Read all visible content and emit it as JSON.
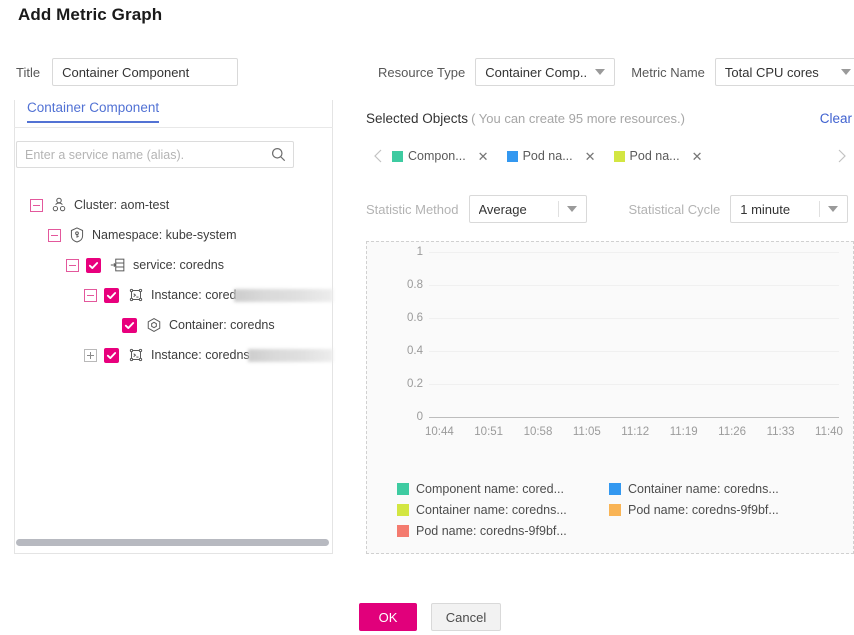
{
  "dialog": {
    "title": "Add Metric Graph"
  },
  "title_field": {
    "label": "Title",
    "value": "Container Component",
    "placeholder": ""
  },
  "resource_type": {
    "label": "Resource Type",
    "value": "Container Comp...",
    "caret_icon": "chevron-down-icon"
  },
  "metric_name": {
    "label": "Metric Name",
    "value": "Total CPU cores",
    "caret_icon": "chevron-down-icon"
  },
  "left_panel": {
    "tab": "Container Component",
    "search_placeholder": "Enter a service name (alias).",
    "search_value": "",
    "search_icon": "search-icon",
    "tree": [
      {
        "label": "Cluster: aom-test",
        "indent": 0,
        "expander": "minus",
        "expander_color": "pink",
        "checkbox": false,
        "icon": "cluster-icon",
        "redacted": false
      },
      {
        "label": "Namespace: kube-system",
        "indent": 1,
        "expander": "minus",
        "expander_color": "pink",
        "checkbox": false,
        "icon": "namespace-icon",
        "redacted": false
      },
      {
        "label": "service: coredns",
        "indent": 2,
        "expander": "minus",
        "expander_color": "pink",
        "checkbox": true,
        "icon": "service-icon",
        "redacted": false
      },
      {
        "label": "Instance: cored",
        "indent": 3,
        "expander": "minus",
        "expander_color": "pink",
        "checkbox": true,
        "icon": "instance-icon",
        "redacted": true,
        "redact_width": 118
      },
      {
        "label": "Container: coredns",
        "indent": 4,
        "expander": "none",
        "expander_color": "pink",
        "checkbox": true,
        "icon": "container-icon",
        "redacted": false
      },
      {
        "label": "Instance: coredns",
        "indent": 3,
        "expander": "plus",
        "expander_color": "gray",
        "checkbox": true,
        "icon": "instance-icon",
        "redacted": true,
        "redact_width": 96
      }
    ]
  },
  "selected_objects": {
    "title": "Selected Objects",
    "hint": "( You can create 95 more resources.)",
    "clear_label": "Clear",
    "prev_icon": "chevron-left-icon",
    "next_icon": "chevron-right-icon",
    "tags": [
      {
        "label": "Compon...",
        "color": "#3ecba1",
        "close_icon": "close-icon"
      },
      {
        "label": "Pod na...",
        "color": "#3398f0",
        "close_icon": "close-icon"
      },
      {
        "label": "Pod na...",
        "color": "#d3e642",
        "close_icon": "close-icon"
      }
    ]
  },
  "statistic_method": {
    "label": "Statistic Method",
    "value": "Average",
    "caret_icon": "chevron-down-icon"
  },
  "statistical_cycle": {
    "label": "Statistical Cycle",
    "value": "1 minute",
    "caret_icon": "chevron-down-icon"
  },
  "chart_data": {
    "type": "line",
    "title": "",
    "xlabel": "",
    "ylabel": "",
    "x": [
      "10:44",
      "10:51",
      "10:58",
      "11:05",
      "11:12",
      "11:19",
      "11:26",
      "11:33",
      "11:40"
    ],
    "y_ticks": [
      "1",
      "0.8",
      "0.6",
      "0.4",
      "0.2",
      "0"
    ],
    "ylim": [
      0,
      1
    ],
    "grid": true,
    "legend_position": "bottom",
    "series": [
      {
        "name": "Component name: cored...",
        "color": "#3ecba1",
        "values": []
      },
      {
        "name": "Container name: coredns...",
        "color": "#3398f0",
        "values": []
      },
      {
        "name": "Container name: coredns...",
        "color": "#d3e642",
        "values": []
      },
      {
        "name": "Pod name: coredns-9f9bf...",
        "color": "#f9b455",
        "values": []
      },
      {
        "name": "Pod name: coredns-9f9bf...",
        "color": "#f47b6f",
        "values": []
      }
    ]
  },
  "footer": {
    "ok_label": "OK",
    "cancel_label": "Cancel"
  }
}
